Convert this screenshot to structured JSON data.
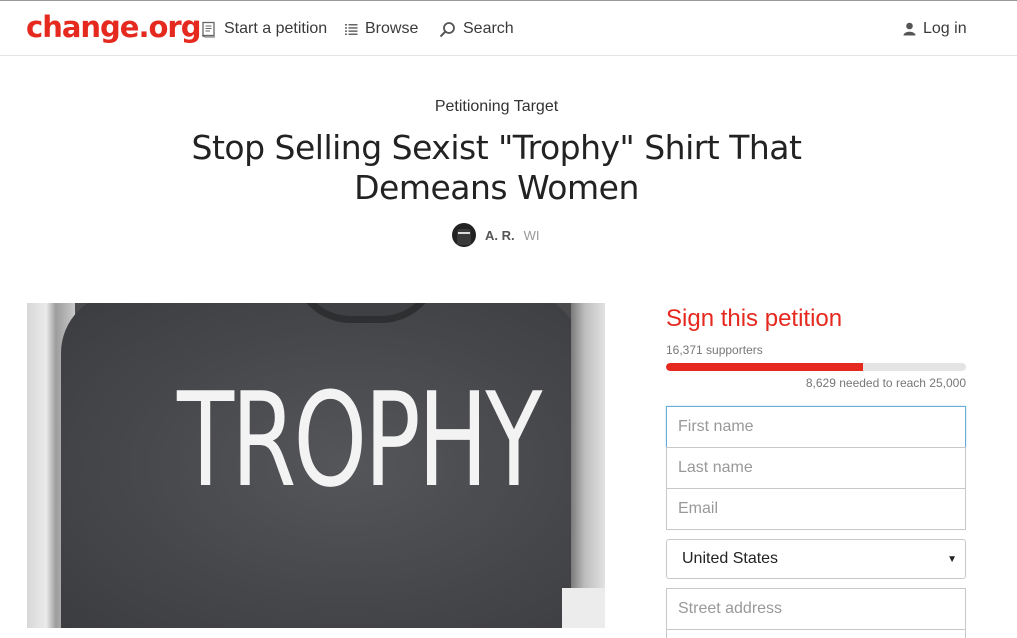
{
  "header": {
    "logo": "change.org",
    "nav": {
      "start": "Start a petition",
      "browse": "Browse",
      "search": "Search",
      "login": "Log in"
    }
  },
  "petition": {
    "target": "Petitioning Target",
    "title": "Stop Selling Sexist \"Trophy\" Shirt That Demeans Women",
    "author_name": "A. R.",
    "author_location": "WI",
    "image_text": "TROPHY"
  },
  "sign": {
    "title": "Sign this petition",
    "supporters": "16,371 supporters",
    "progress_fraction": 0.655,
    "needed": "8,629 needed to reach 25,000",
    "first_name_placeholder": "First name",
    "last_name_placeholder": "Last name",
    "email_placeholder": "Email",
    "country": "United States",
    "street_placeholder": "Street address"
  },
  "colors": {
    "brand": "#e5291f",
    "progress_track": "#e4e4e4"
  },
  "icons": [
    "petition-icon",
    "list-icon",
    "search-icon",
    "user-icon",
    "dropdown-caret-icon"
  ]
}
